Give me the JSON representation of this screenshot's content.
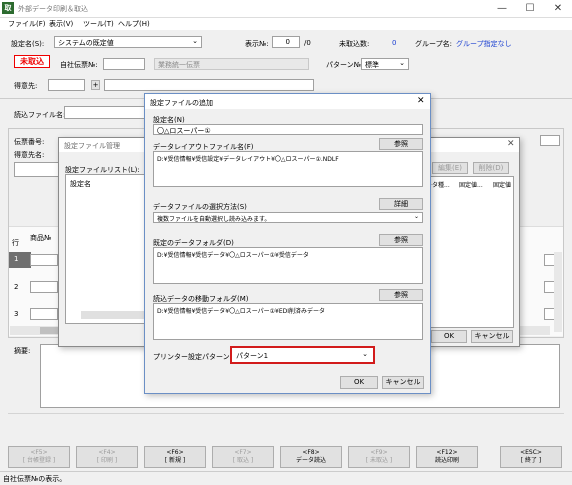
{
  "window": {
    "title": "外部データ印刷＆取込",
    "icon": "取",
    "min": "—",
    "max": "☐",
    "close": "✕"
  },
  "menu": [
    "ファイル(F)",
    "表示(V)",
    "ツール(T)",
    "ヘルプ(H)"
  ],
  "header": {
    "setting_label": "設定名(S):",
    "setting_value": "システムの既定値",
    "display_no_label": "表示№:",
    "display_no_value": "0",
    "display_no_total": "/0",
    "unimported_label": "未取込数:",
    "unimported_value": "0",
    "group_label": "グループ名:",
    "group_value": "グループ指定なし"
  },
  "row2": {
    "status": "未取込",
    "slip_no_label": "自社伝票№:",
    "business_label": "業務統一伝票",
    "pattern_label": "パターン№:",
    "pattern_value": "標準"
  },
  "row3": {
    "customer_label": "得意先:",
    "plus": "+"
  },
  "row4": {
    "file_label": "読込ファイル名:"
  },
  "bg": {
    "slip_no": "伝票番号:",
    "dest": "得意先名:",
    "row_label": "行",
    "product_label": "商品№",
    "rows": [
      "1",
      "2",
      "3"
    ],
    "notes_label": "摘要:"
  },
  "mgmt_dialog": {
    "title": "設定ファイル管理",
    "list_label": "設定ファイルリスト(L):",
    "column": "設定名",
    "edit": "編集(E)",
    "delete": "削除(D)",
    "col1": "ータ種...",
    "col2": "固定値...",
    "col3": "固定値",
    "ok": "OK",
    "cancel": "キャンセル",
    "close": "✕"
  },
  "add_dialog": {
    "title": "設定ファイルの追加",
    "close": "✕",
    "name_label": "設定名(N)",
    "name_value": "〇△ロスーパー①",
    "layout_label": "データレイアウトファイル名(F)",
    "layout_button": "参照",
    "layout_value": "D:¥受信情報¥受信設定¥データレイアウト¥〇△ロスーパー①.NDLF",
    "select_label": "データファイルの選択方法(S)",
    "select_button": "詳細",
    "select_value": "複数ファイルを自動選択し読み込みます。",
    "folder_label": "既定のデータフォルダ(D)",
    "folder_button": "参照",
    "folder_value": "D:¥受信情報¥受信データ¥〇△ロスーパー①¥受信データ",
    "move_label": "読込データの移動フォルダ(M)",
    "move_button": "参照",
    "move_value": "D:¥受信情報¥受信データ¥〇△ロスーパー①¥EDI削済みデータ",
    "printer_label": "プリンター設定パターン(P):",
    "printer_value": "パターン1",
    "ok": "OK",
    "cancel": "キャンセル"
  },
  "fkeys": [
    {
      "key": "<F5>",
      "label": "[ 台帳登録 ]"
    },
    {
      "key": "<F4>",
      "label": "[ 印刷 ]"
    },
    {
      "key": "<F6>",
      "label": "[ 新規 ]"
    },
    {
      "key": "<F7>",
      "label": "[ 取込 ]"
    },
    {
      "key": "<F8>",
      "label": "データ読込"
    },
    {
      "key": "<F9>",
      "label": "[ 未取込 ]"
    },
    {
      "key": "<F12>",
      "label": "読込印刷"
    },
    {
      "key": "<ESC>",
      "label": "[ 終了 ]"
    }
  ],
  "status": "自社伝票№の表示。"
}
